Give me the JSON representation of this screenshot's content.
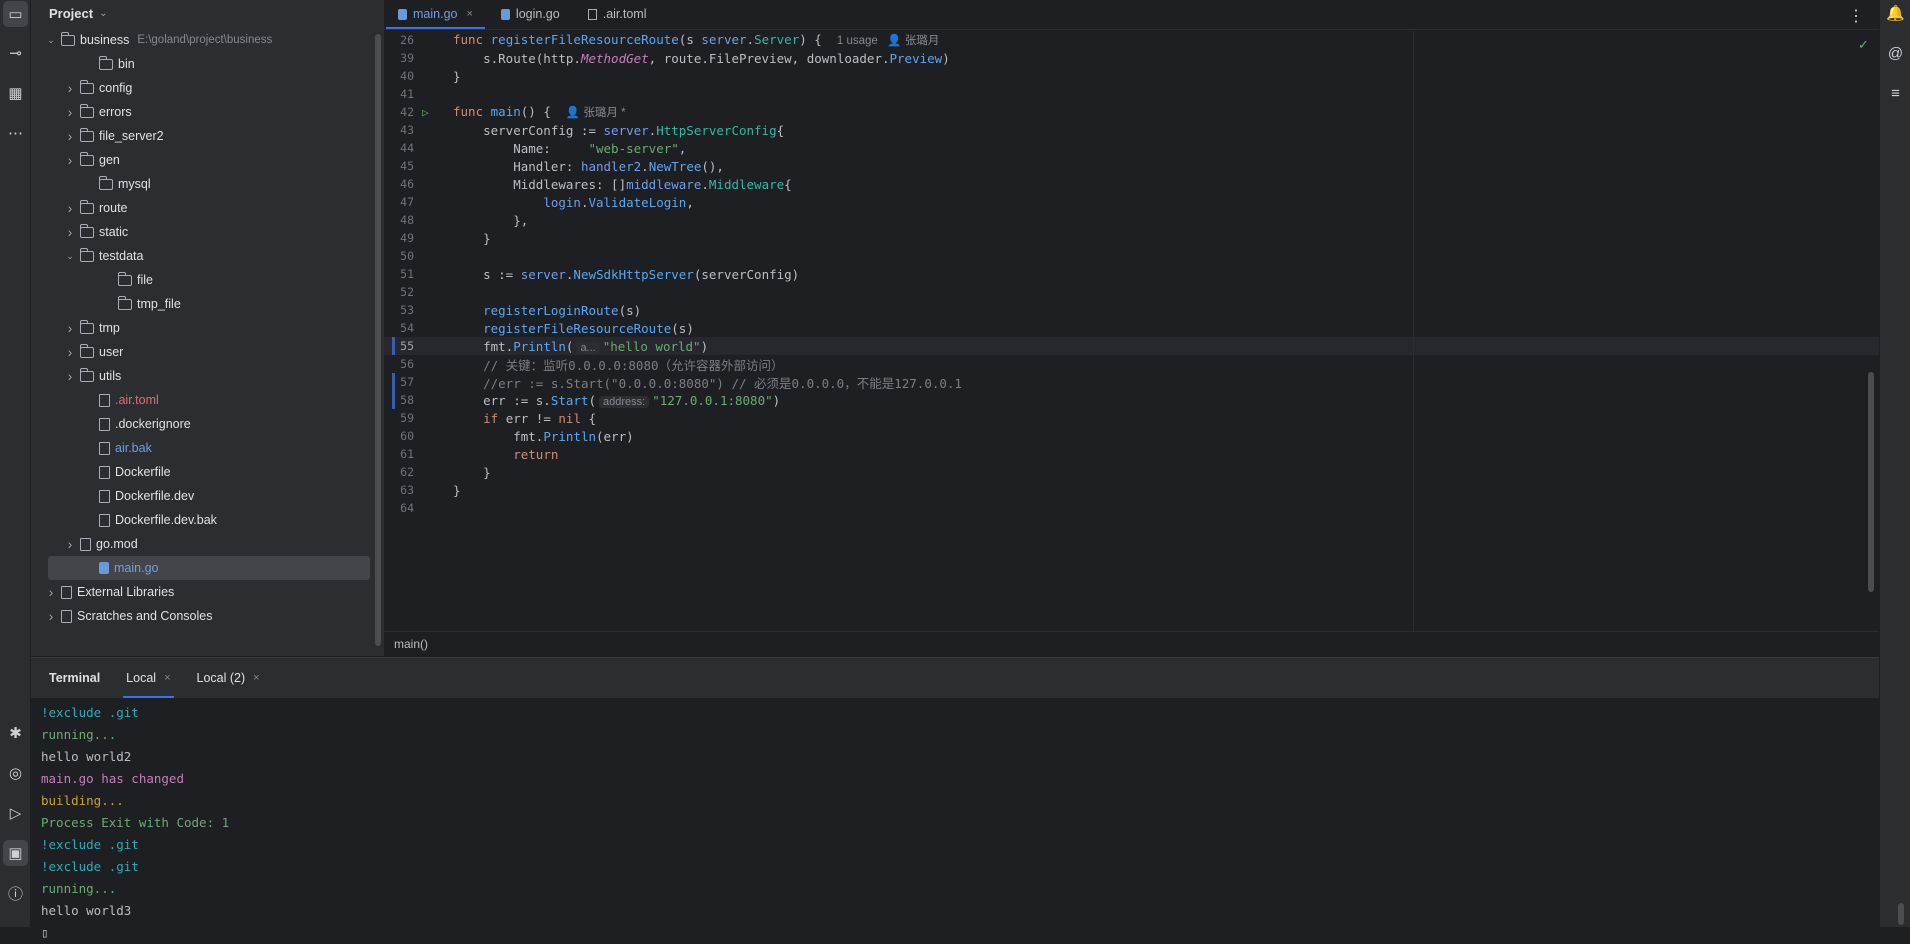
{
  "project": {
    "title": "Project",
    "tree": [
      {
        "label": "business",
        "path": "E:\\goland\\project\\business",
        "kind": "folder",
        "arrow": "open",
        "indent": 0
      },
      {
        "label": "bin",
        "kind": "folder",
        "arrow": "",
        "indent": 2
      },
      {
        "label": "config",
        "kind": "folder",
        "arrow": "closed",
        "indent": 1
      },
      {
        "label": "errors",
        "kind": "folder",
        "arrow": "closed",
        "indent": 1
      },
      {
        "label": "file_server2",
        "kind": "folder",
        "arrow": "closed",
        "indent": 1
      },
      {
        "label": "gen",
        "kind": "folder",
        "arrow": "closed",
        "indent": 1
      },
      {
        "label": "mysql",
        "kind": "folder",
        "arrow": "",
        "indent": 2
      },
      {
        "label": "route",
        "kind": "folder",
        "arrow": "closed",
        "indent": 1
      },
      {
        "label": "static",
        "kind": "folder",
        "arrow": "closed",
        "indent": 1
      },
      {
        "label": "testdata",
        "kind": "folder",
        "arrow": "open",
        "indent": 1
      },
      {
        "label": "file",
        "kind": "folder",
        "arrow": "",
        "indent": 3
      },
      {
        "label": "tmp_file",
        "kind": "folder",
        "arrow": "",
        "indent": 3
      },
      {
        "label": "tmp",
        "kind": "folder",
        "arrow": "closed",
        "indent": 1
      },
      {
        "label": "user",
        "kind": "folder",
        "arrow": "closed",
        "indent": 1
      },
      {
        "label": "utils",
        "kind": "folder",
        "arrow": "closed",
        "indent": 1
      },
      {
        "label": ".air.toml",
        "kind": "file",
        "arrow": "",
        "indent": 2,
        "color": "#e06c75"
      },
      {
        "label": ".dockerignore",
        "kind": "file",
        "arrow": "",
        "indent": 2
      },
      {
        "label": "air.bak",
        "kind": "file",
        "arrow": "",
        "indent": 2,
        "color": "#6f9fe8"
      },
      {
        "label": "Dockerfile",
        "kind": "file",
        "arrow": "",
        "indent": 2
      },
      {
        "label": "Dockerfile.dev",
        "kind": "file",
        "arrow": "",
        "indent": 2
      },
      {
        "label": "Dockerfile.dev.bak",
        "kind": "file",
        "arrow": "",
        "indent": 2
      },
      {
        "label": "go.mod",
        "kind": "file",
        "arrow": "closed",
        "indent": 1
      },
      {
        "label": "main.go",
        "kind": "go",
        "arrow": "",
        "indent": 2,
        "color": "#6f9fe8",
        "selected": true
      },
      {
        "label": "External Libraries",
        "kind": "lib",
        "arrow": "closed",
        "indent": 0
      },
      {
        "label": "Scratches and Consoles",
        "kind": "lib",
        "arrow": "closed",
        "indent": 0
      }
    ]
  },
  "tabs": [
    {
      "label": "main.go",
      "active": true,
      "close": "×",
      "icon": "go"
    },
    {
      "label": "login.go",
      "active": false,
      "close": "",
      "icon": "go"
    },
    {
      "label": ".air.toml",
      "active": false,
      "close": "",
      "icon": "toml"
    }
  ],
  "editor": {
    "lines": [
      {
        "n": "26",
        "html": "<span class='kw'>func</span> <span class='fn'>registerFileResourceRoute</span>(s <span class='pk'>server</span>.<span class='ty'>Server</span>) {  <span class='author'>1 usage   👤 张璐月</span>"
      },
      {
        "n": "39",
        "html": "    s.Route(http.<span class='it'>MethodGet</span>, route.FilePreview, downloader.<span class='fn'>Preview</span>)"
      },
      {
        "n": "40",
        "html": "}"
      },
      {
        "n": "41",
        "html": ""
      },
      {
        "n": "42",
        "html": "<span class='kw'>func</span> <span class='fn'>main</span>() {  <span class='author'>👤 张璐月 *</span>"
      },
      {
        "n": "43",
        "html": "    serverConfig := <span class='pk'>server</span>.<span class='ty'>HttpServerConfig</span>{"
      },
      {
        "n": "44",
        "html": "        Name:     <span class='str'>\"web-server\"</span>,"
      },
      {
        "n": "45",
        "html": "        Handler: <span class='pk'>handler2</span>.<span class='fn'>NewTree</span>(),"
      },
      {
        "n": "46",
        "html": "        Middlewares: []<span class='pk'>middleware</span>.<span class='ty'>Middleware</span>{"
      },
      {
        "n": "47",
        "html": "            <span class='pk'>login</span>.<span class='fn'>ValidateLogin</span>,"
      },
      {
        "n": "48",
        "html": "        },"
      },
      {
        "n": "49",
        "html": "    }"
      },
      {
        "n": "50",
        "html": ""
      },
      {
        "n": "51",
        "html": "    s := <span class='pk'>server</span>.<span class='fn'>NewSdkHttpServer</span>(serverConfig)"
      },
      {
        "n": "52",
        "html": ""
      },
      {
        "n": "53",
        "html": "    <span class='fn'>registerLoginRoute</span>(s)"
      },
      {
        "n": "54",
        "html": "    <span class='fn'>registerFileResourceRoute</span>(s)"
      },
      {
        "n": "55",
        "html": "    fmt.<span class='fn'>Println</span>(<span class='hint'>a...</span><span class='str'>\"hello world\"</span>)"
      },
      {
        "n": "56",
        "html": "    <span class='cm'>// 关键：监听0.0.0.0:8080（允许容器外部访问）</span>"
      },
      {
        "n": "57",
        "html": "    <span class='cm'>//err := s.Start(\"0.0.0.0:8080\") // 必须是0.0.0.0，不能是127.0.0.1</span>"
      },
      {
        "n": "58",
        "html": "    err := s.<span class='fn'>Start</span>(<span class='hint'>address:</span><span class='str'>\"127.0.0.1:8080\"</span>)"
      },
      {
        "n": "59",
        "html": "    <span class='kw'>if</span> err != <span class='kw'>nil</span> {"
      },
      {
        "n": "60",
        "html": "        fmt.<span class='fn'>Println</span>(err)"
      },
      {
        "n": "61",
        "html": "        <span class='kw'>return</span>"
      },
      {
        "n": "62",
        "html": "    }"
      },
      {
        "n": "63",
        "html": "}"
      },
      {
        "n": "64",
        "html": ""
      }
    ],
    "breadcrumb": "main()"
  },
  "terminal": {
    "title": "Terminal",
    "tabs": [
      {
        "label": "Local",
        "active": true,
        "close": "×"
      },
      {
        "label": "Local (2)",
        "active": false,
        "close": "×"
      }
    ],
    "lines": [
      {
        "text": "!exclude .git",
        "cls": "t-cyan"
      },
      {
        "text": "running...",
        "cls": "t-green"
      },
      {
        "text": "hello world2",
        "cls": "t-white"
      },
      {
        "text": "main.go has changed",
        "cls": "t-mag"
      },
      {
        "text": "building...",
        "cls": "t-yellow"
      },
      {
        "text": "Process Exit with Code: 1",
        "cls": "t-green"
      },
      {
        "text": "!exclude .git",
        "cls": "t-cyan"
      },
      {
        "text": "!exclude .git",
        "cls": "t-cyan"
      },
      {
        "text": "running...",
        "cls": "t-green"
      },
      {
        "text": "hello world3",
        "cls": "t-white"
      },
      {
        "text": "▯",
        "cls": "t-white"
      }
    ]
  },
  "icons": {
    "left": [
      "folder-icon",
      "commit-icon",
      "structure-icon",
      "more-icon"
    ],
    "left_bottom": [
      "debug-icon",
      "services-icon",
      "run-icon",
      "terminal-icon",
      "problems-icon"
    ],
    "right": [
      "notifications-icon",
      "ai-icon",
      "database-icon"
    ]
  }
}
